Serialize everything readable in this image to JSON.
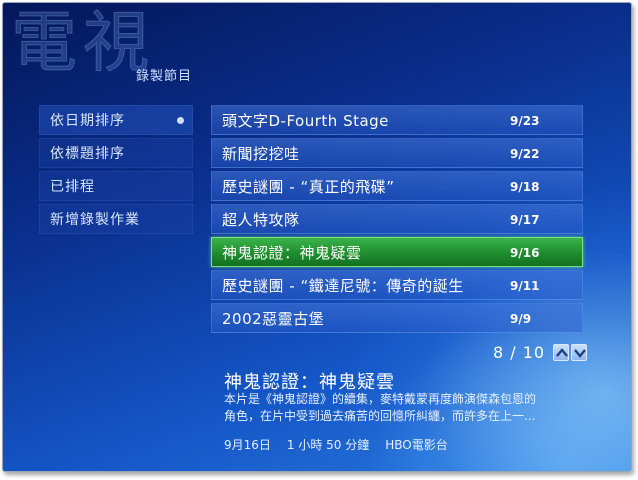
{
  "header": {
    "watermark": "電視",
    "subtitle": "錄製節目"
  },
  "sidebar": {
    "items": [
      {
        "label": "依日期排序"
      },
      {
        "label": "依標題排序"
      },
      {
        "label": "已排程"
      },
      {
        "label": "新增錄製作業"
      }
    ]
  },
  "recordings": [
    {
      "title": "頭文字D-Fourth Stage",
      "date": "9/23"
    },
    {
      "title": "新聞挖挖哇",
      "date": "9/22"
    },
    {
      "title": "歷史謎團 - “真正的飛碟”",
      "date": "9/18"
    },
    {
      "title": "超人特攻隊",
      "date": "9/17"
    },
    {
      "title": "神鬼認證：神鬼疑雲",
      "date": "9/16"
    },
    {
      "title": "歷史謎團 - “鐵達尼號：傳奇的誕生",
      "date": "9/11"
    },
    {
      "title": "2002惡靈古堡",
      "date": "9/9"
    }
  ],
  "pager": {
    "text": "8 / 10"
  },
  "detail": {
    "title": "神鬼認證：神鬼疑雲",
    "description_line1": "本片是《神鬼認證》的續集，麥特戴蒙再度飾演傑森包恩的",
    "description_line2": "角色，在片中受到過去痛苦的回憶所糾纏，而許多在上一...",
    "date": "9月16日",
    "duration": "1 小時 50 分鐘",
    "channel": "HBO電影台"
  },
  "colors": {
    "selection": "#1f8d2f",
    "background": "#0a2f8e"
  }
}
